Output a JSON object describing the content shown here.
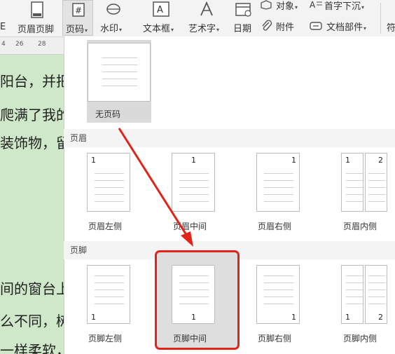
{
  "ribbon": {
    "header_footer": "页眉页脚",
    "page_number": "页码",
    "watermark": "水印",
    "text_box": "文本框",
    "word_art": "艺术字",
    "date": "日期",
    "object": "对象",
    "drop_cap": "首字下沉",
    "attachment": "附件",
    "doc_parts": "文档部件",
    "left_cut_1": "E",
    "right_cut_1": "符",
    "dropdown_glyph": "▾"
  },
  "ruler": {
    "ticks": [
      "4",
      "26",
      "28"
    ]
  },
  "document": {
    "lines": [
      "阳台，并把",
      "爬满了我的",
      "装饰物，留",
      "间的窗台上",
      "么不同，树",
      "一样柔软，"
    ]
  },
  "page_number_menu": {
    "none": {
      "label": "无页码"
    },
    "header_section": "页眉",
    "header_items": [
      {
        "label": "页眉左侧",
        "number": "1"
      },
      {
        "label": "页眉中间",
        "number": "1"
      },
      {
        "label": "页眉右侧",
        "number": "1"
      },
      {
        "label": "页眉内侧",
        "number": "1",
        "number2": "2"
      }
    ],
    "footer_section": "页脚",
    "footer_items": [
      {
        "label": "页脚左侧",
        "number": "1"
      },
      {
        "label": "页脚中间",
        "number": "1"
      },
      {
        "label": "页脚右侧",
        "number": "1"
      },
      {
        "label": "页脚内侧",
        "number": "1",
        "number2": "2"
      }
    ]
  },
  "colors": {
    "annotation_red": "#e2231a",
    "doc_bg": "#cfe8c9"
  }
}
